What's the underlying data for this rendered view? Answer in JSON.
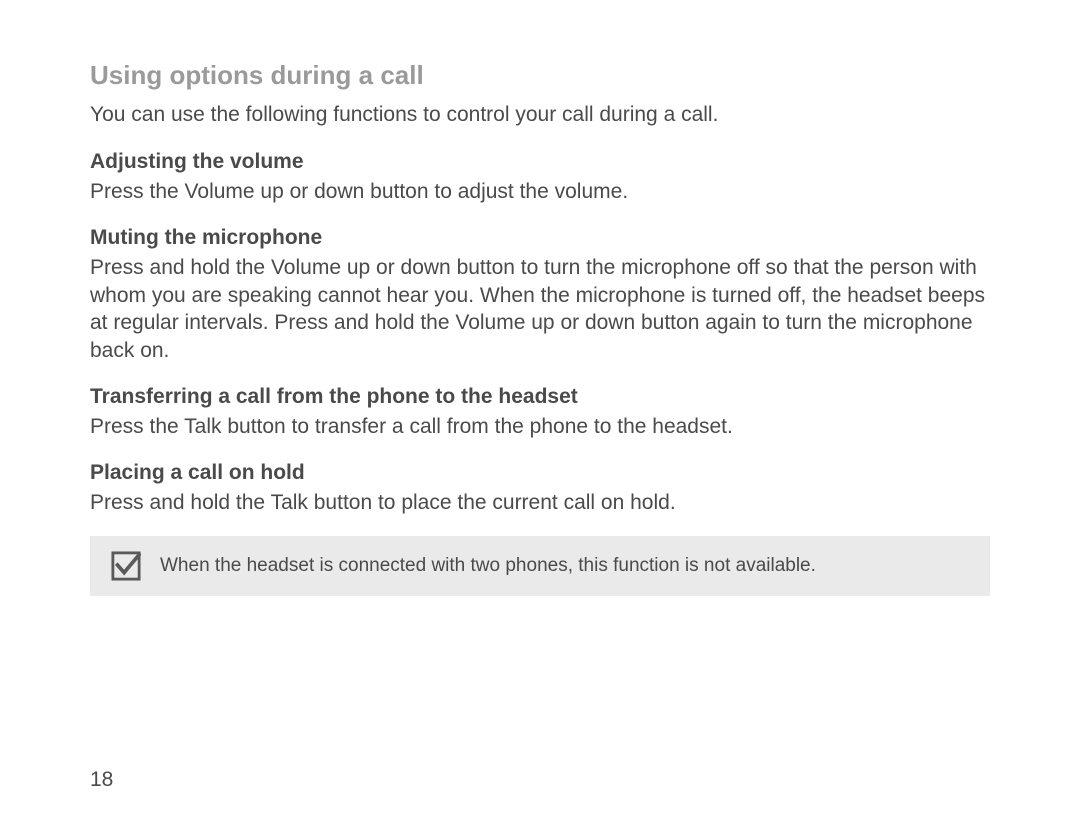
{
  "section_title": "Using options during a call",
  "intro": "You can use the following functions to control your call during a call.",
  "subsections": [
    {
      "title": "Adjusting the volume",
      "body": "Press the Volume up or down button to adjust the volume."
    },
    {
      "title": "Muting the microphone",
      "body": "Press and hold the Volume up or down button to turn the microphone off so that the person with whom you are speaking cannot hear you. When the microphone is turned off, the headset beeps at regular intervals. Press and hold the Volume up or down button again to turn the microphone back on."
    },
    {
      "title": "Transferring a call from the phone to the headset",
      "body": "Press the Talk button to transfer a call from the phone to the headset."
    },
    {
      "title": "Placing a call on hold",
      "body": "Press and hold the Talk button to place the current call on hold."
    }
  ],
  "note": {
    "icon": "checkbox-checked-icon",
    "text": "When the headset is connected with two phones, this function is not available."
  },
  "page_number": "18"
}
